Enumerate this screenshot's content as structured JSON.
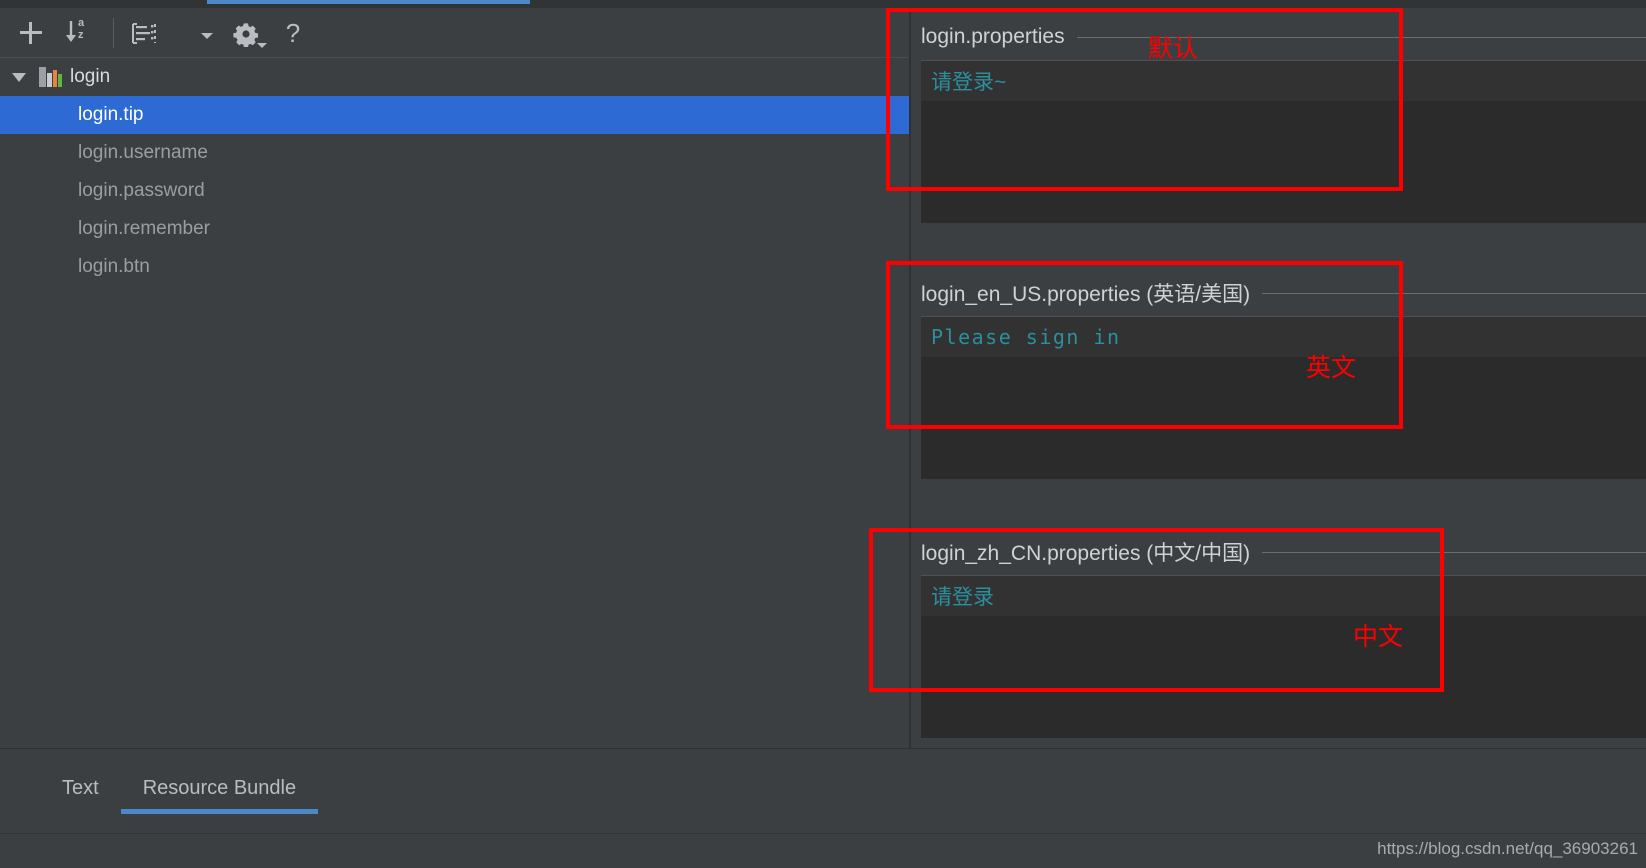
{
  "toolbar": {
    "buttons": [
      {
        "name": "add-property-button",
        "icon": "plus-icon",
        "tooltip": "Add Property"
      },
      {
        "name": "sort-alphabetically-button",
        "icon": "sort-az-icon",
        "tooltip": "Sort Alphabetically"
      },
      {
        "name": "group-by-prefix-button",
        "icon": "group-list-icon",
        "tooltip": "Group by Prefix"
      },
      {
        "name": "show-options-button",
        "icon": "chevron-down-icon",
        "tooltip": "Options"
      },
      {
        "name": "settings-button",
        "icon": "gear-icon",
        "tooltip": "Settings"
      },
      {
        "name": "help-button",
        "icon": "question-mark-icon",
        "tooltip": "Help"
      }
    ]
  },
  "tree": {
    "root": {
      "label": "login",
      "icon": "resource-bundle-icon",
      "expanded": true
    },
    "items": [
      {
        "label": "login.tip",
        "selected": true
      },
      {
        "label": "login.username",
        "selected": false
      },
      {
        "label": "login.password",
        "selected": false
      },
      {
        "label": "login.remember",
        "selected": false
      },
      {
        "label": "login.btn",
        "selected": false
      }
    ]
  },
  "locales": [
    {
      "title": "login.properties",
      "value": "请登录~",
      "mono": false,
      "annotation": "默认"
    },
    {
      "title": "login_en_US.properties (英语/美国)",
      "value": "Please sign in",
      "mono": true,
      "annotation": "英文"
    },
    {
      "title": "login_zh_CN.properties (中文/中国)",
      "value": "请登录",
      "mono": false,
      "annotation": "中文"
    }
  ],
  "bottom_tabs": [
    {
      "label": "Text",
      "active": false
    },
    {
      "label": "Resource Bundle",
      "active": true
    }
  ],
  "watermark": "https://blog.csdn.net/qq_36903261",
  "colors": {
    "background": "#3c3f41",
    "editor_background": "#2b2b2b",
    "selection_blue": "#2d6ad4",
    "accent_blue": "#4a88c7",
    "value_text": "#2b8f9e",
    "annotation_red": "#fe0000"
  }
}
